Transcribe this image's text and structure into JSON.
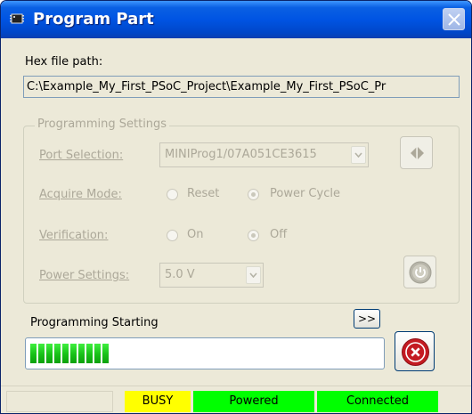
{
  "window": {
    "title": "Program Part"
  },
  "hex": {
    "label": "Hex file path:",
    "value": "C:\\Example_My_First_PSoC_Project\\Example_My_First_PSoC_Pr"
  },
  "settings": {
    "legend": "Programming Settings",
    "port": {
      "label": "Port Selection:",
      "value": "MINIProg1/07A051CE3615"
    },
    "acquire": {
      "label": "Acquire Mode:",
      "options": [
        "Reset",
        "Power Cycle"
      ],
      "selected": "Power Cycle"
    },
    "verification": {
      "label": "Verification:",
      "options": [
        "On",
        "Off"
      ],
      "selected": "Off"
    },
    "power": {
      "label": "Power Settings:",
      "value": "5.0 V"
    }
  },
  "progress": {
    "status": "Programming Starting",
    "expand_label": ">>",
    "fraction": 0.25,
    "segments": 10
  },
  "statusbar": {
    "busy": "BUSY",
    "powered": "Powered",
    "connected": "Connected"
  },
  "colors": {
    "busy": "#ffff00",
    "ok": "#00ff00",
    "title": "#0054e3",
    "stop": "#d8202a"
  },
  "icons": {
    "app": "chip-icon",
    "close": "close-icon",
    "toggle": "swap-arrows-icon",
    "power": "power-icon",
    "stop": "stop-icon"
  }
}
